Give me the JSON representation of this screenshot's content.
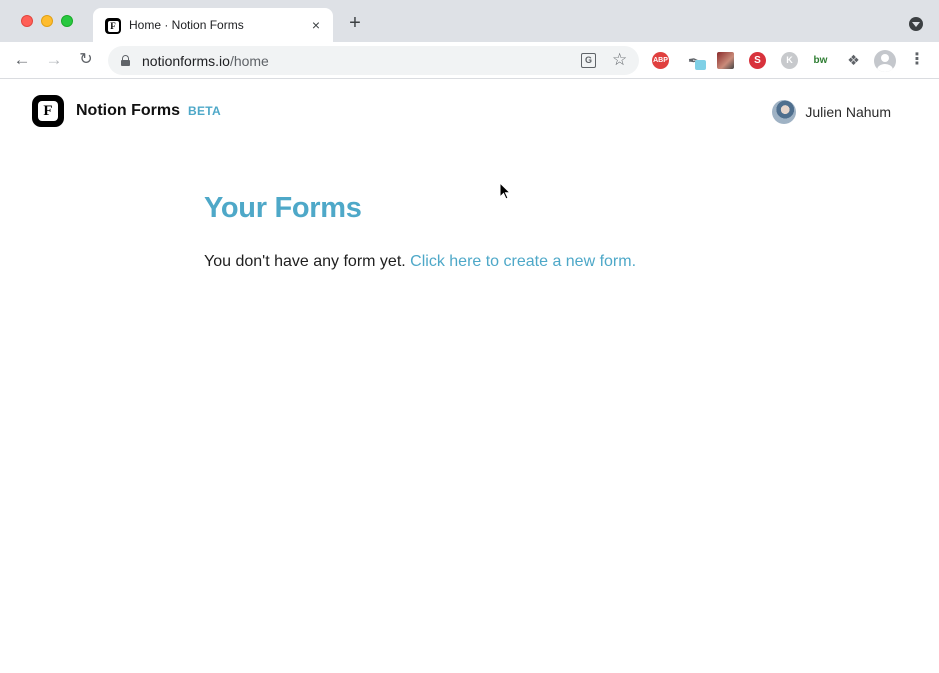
{
  "browser": {
    "tab_title": "Home · Notion Forms",
    "tab_close": "×",
    "new_tab": "+",
    "url_host": "notionforms.io",
    "url_path": "/home",
    "extensions": {
      "abp": "ABP",
      "seo": "S",
      "k": "K",
      "bw": "bw"
    },
    "icons": [
      "back-arrow-icon",
      "forward-arrow-icon",
      "reload-icon",
      "lock-icon",
      "translate-icon",
      "star-icon",
      "puzzle-icon",
      "profile-icon",
      "kebab-menu-icon"
    ]
  },
  "header": {
    "brand_name": "Notion Forms",
    "brand_badge": "BETA",
    "user_name": "Julien Nahum"
  },
  "main": {
    "title": "Your Forms",
    "empty_message": "You don't have any form yet.",
    "create_link": "Click here to create a new form."
  },
  "colors": {
    "accent": "#4ea8c8",
    "chrome": "#dee1e6"
  }
}
